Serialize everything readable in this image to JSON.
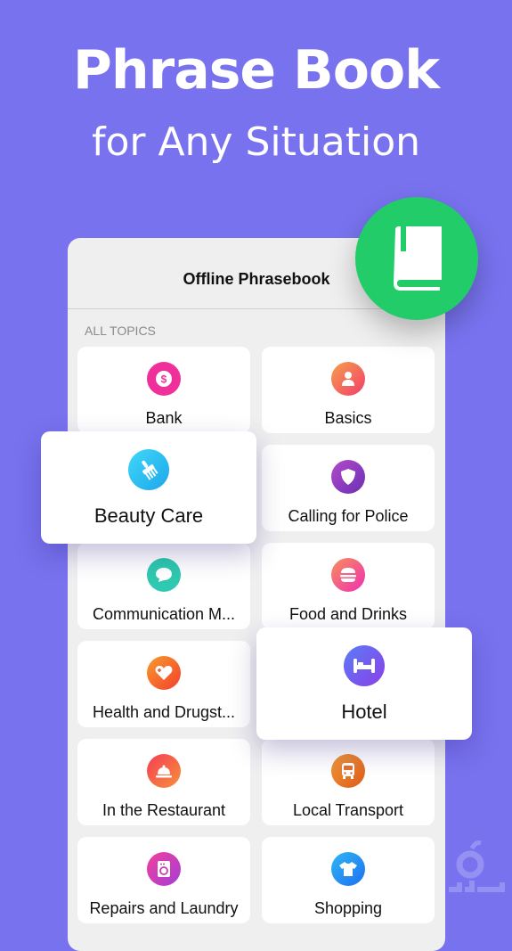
{
  "hero": {
    "title": "Phrase Book",
    "subtitle": "for Any Situation"
  },
  "app": {
    "title": "Offline Phrasebook",
    "section_label": "ALL TOPICS"
  },
  "badge": {
    "icon": "book-icon",
    "color": "#22cc68"
  },
  "topics": [
    {
      "label": "Bank",
      "icon": "dollar-icon",
      "color": "#f0309a"
    },
    {
      "label": "Basics",
      "icon": "person-icon",
      "color": "#f45d55"
    },
    {
      "label": "Beauty Care",
      "icon": "comb-icon",
      "color": "#25c0ee",
      "highlighted": true
    },
    {
      "label": "Calling for Police",
      "icon": "shield-icon",
      "color": "#8e3fbf"
    },
    {
      "label": "Communication M...",
      "icon": "chat-bubble-icon",
      "color": "#2ec9ae"
    },
    {
      "label": "Food and Drinks",
      "icon": "burger-icon",
      "color": "#f54c90"
    },
    {
      "label": "Health and Drugst...",
      "icon": "heart-plus-icon",
      "color": "#f6582a"
    },
    {
      "label": "Hotel",
      "icon": "bed-icon",
      "color": "#6a5cf0",
      "highlighted": true
    },
    {
      "label": "In the Restaurant",
      "icon": "cloche-icon",
      "color": "#f55845"
    },
    {
      "label": "Local Transport",
      "icon": "bus-icon",
      "color": "#ea7c25"
    },
    {
      "label": "Repairs and Laundry",
      "icon": "washing-machine-icon",
      "color": "#d53fb8"
    },
    {
      "label": "Shopping",
      "icon": "tshirt-icon",
      "color": "#2490f0"
    }
  ]
}
